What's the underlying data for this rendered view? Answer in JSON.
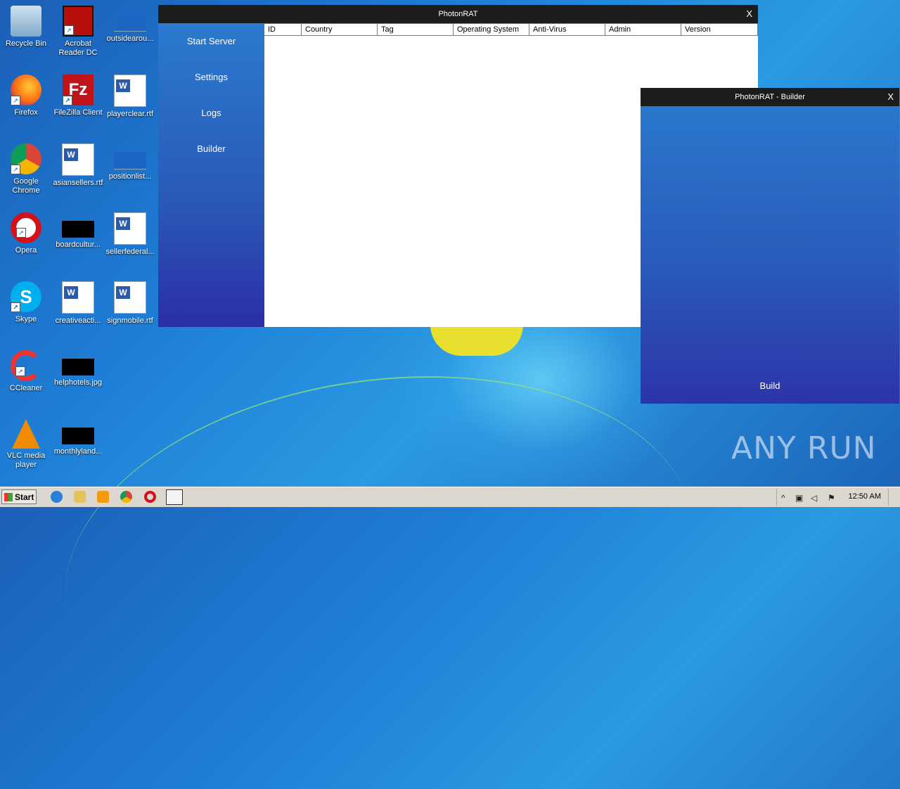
{
  "desktop": {
    "icons": [
      {
        "label": "Recycle Bin"
      },
      {
        "label": "Acrobat Reader DC"
      },
      {
        "label": "outsidearou..."
      },
      {
        "label": "Firefox"
      },
      {
        "label": "FileZilla Client"
      },
      {
        "label": "playerclear.rtf"
      },
      {
        "label": "Google Chrome"
      },
      {
        "label": "asiansellers.rtf"
      },
      {
        "label": "positionlist..."
      },
      {
        "label": "Opera"
      },
      {
        "label": "boardcultur..."
      },
      {
        "label": "sellerfederal..."
      },
      {
        "label": "Skype"
      },
      {
        "label": "creativeacti..."
      },
      {
        "label": "signmobile.rtf"
      },
      {
        "label": "CCleaner"
      },
      {
        "label": "helphotels.jpg"
      },
      {
        "label": "VLC media player"
      },
      {
        "label": "monthlyland..."
      }
    ]
  },
  "main_window": {
    "title": "PhotonRAT",
    "close": "X",
    "sidebar": [
      "Start Server",
      "Settings",
      "Logs",
      "Builder"
    ],
    "columns": [
      "ID",
      "Country",
      "Tag",
      "Operating System",
      "Anti-Virus",
      "Admin",
      "Version"
    ]
  },
  "builder_window": {
    "title": "PhotonRAT - Builder",
    "close": "X",
    "build_label": "Build"
  },
  "watermark": "ANY RUN",
  "taskbar": {
    "start_label": "Start",
    "clock": "12:50 AM"
  }
}
